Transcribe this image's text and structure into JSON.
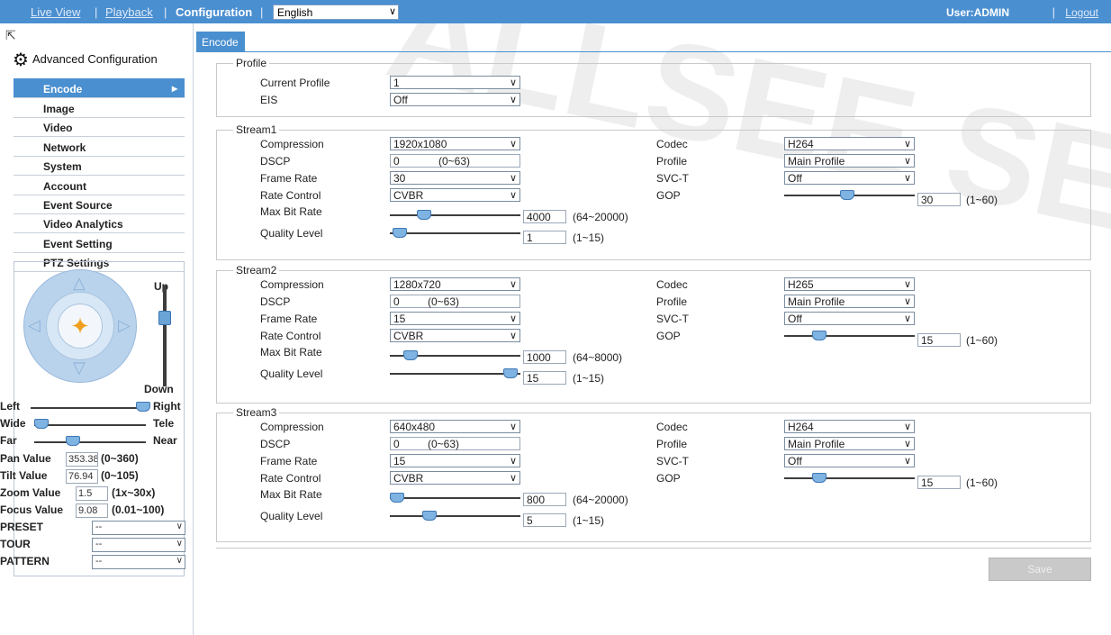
{
  "topbar": {
    "live_view": "Live View",
    "playback": "Playback",
    "configuration": "Configuration",
    "separator": "|",
    "language": "English",
    "user": "User:ADMIN",
    "logout": "Logout"
  },
  "sidebar": {
    "title": "Advanced Configuration",
    "items": [
      {
        "label": "Encode",
        "active": true
      },
      {
        "label": "Image"
      },
      {
        "label": "Video"
      },
      {
        "label": "Network"
      },
      {
        "label": "System"
      },
      {
        "label": "Account"
      },
      {
        "label": "Event Source"
      },
      {
        "label": "Video Analytics"
      },
      {
        "label": "Event Setting"
      },
      {
        "label": "PTZ Settings"
      }
    ]
  },
  "ptz": {
    "up": "Up",
    "down": "Down",
    "left": "Left",
    "right": "Right",
    "wide": "Wide",
    "tele": "Tele",
    "far": "Far",
    "near": "Near",
    "pan_label": "Pan Value",
    "pan_value": "353.38",
    "pan_range": "(0~360)",
    "tilt_label": "Tilt Value",
    "tilt_value": "76.94",
    "tilt_range": "(0~105)",
    "zoom_label": "Zoom Value",
    "zoom_value": "1.5",
    "zoom_range": "(1x~30x)",
    "focus_label": "Focus Value",
    "focus_value": "9.08",
    "focus_range": "(0.01~100)",
    "preset_label": "PRESET",
    "preset_value": "--",
    "tour_label": "TOUR",
    "tour_value": "--",
    "pattern_label": "PATTERN",
    "pattern_value": "--"
  },
  "tab": {
    "label": "Encode"
  },
  "profile": {
    "legend": "Profile",
    "current_profile_label": "Current Profile",
    "current_profile_value": "1",
    "eis_label": "EIS",
    "eis_value": "Off"
  },
  "labels": {
    "compression": "Compression",
    "dscp": "DSCP",
    "frame_rate": "Frame Rate",
    "rate_control": "Rate Control",
    "max_bit_rate": "Max Bit Rate",
    "quality_level": "Quality Level",
    "codec": "Codec",
    "profile": "Profile",
    "svct": "SVC-T",
    "gop": "GOP",
    "dscp_range": "(0~63)",
    "quality_range": "(1~15)",
    "gop_range": "(1~60)"
  },
  "streams": [
    {
      "legend": "Stream1",
      "compression": "1920x1080",
      "dscp": "0",
      "frame_rate": "30",
      "rate_control": "CVBR",
      "max_bit_rate": "4000",
      "max_bit_rate_range": "(64~20000)",
      "quality": "1",
      "codec": "H264",
      "profile": "Main Profile",
      "svct": "Off",
      "gop": "30"
    },
    {
      "legend": "Stream2",
      "compression": "1280x720",
      "dscp": "0",
      "frame_rate": "15",
      "rate_control": "CVBR",
      "max_bit_rate": "1000",
      "max_bit_rate_range": "(64~8000)",
      "quality": "15",
      "codec": "H265",
      "profile": "Main Profile",
      "svct": "Off",
      "gop": "15"
    },
    {
      "legend": "Stream3",
      "compression": "640x480",
      "dscp": "0",
      "frame_rate": "15",
      "rate_control": "CVBR",
      "max_bit_rate": "800",
      "max_bit_rate_range": "(64~20000)",
      "quality": "5",
      "codec": "H264",
      "profile": "Main Profile",
      "svct": "Off",
      "gop": "15"
    }
  ],
  "save_label": "Save",
  "watermark": "ALLSEE SECURITY",
  "colors": {
    "accent": "#4a8fd0",
    "slider_thumb": "#7fb3e2"
  }
}
